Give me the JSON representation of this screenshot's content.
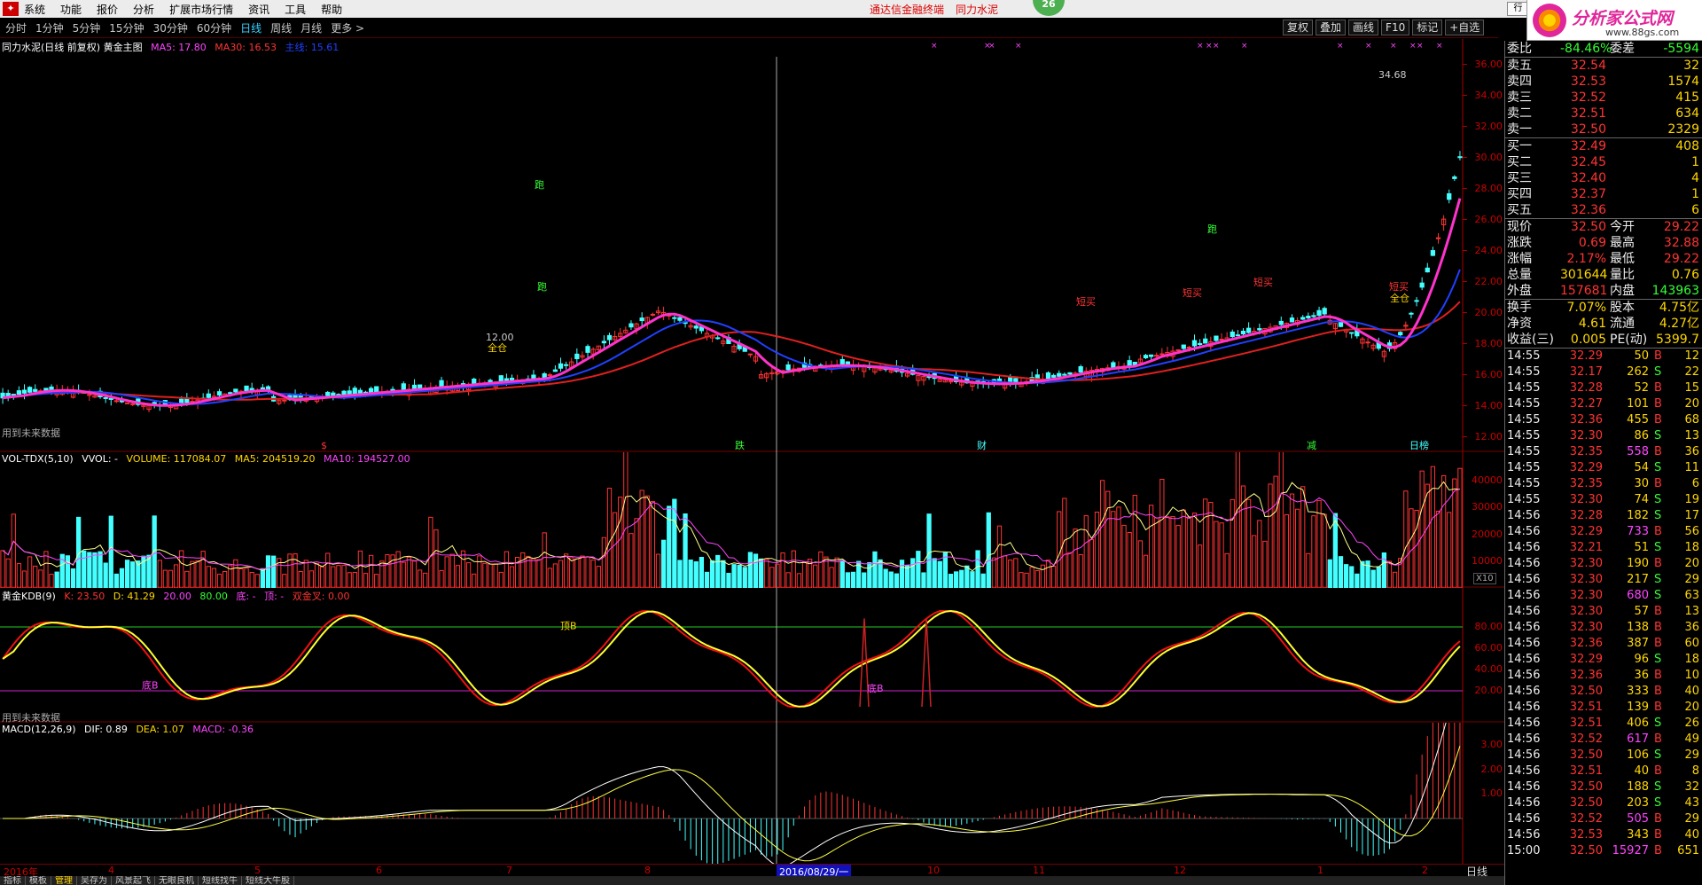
{
  "menu": {
    "items": [
      "系统",
      "功能",
      "报价",
      "分析",
      "扩展市场行情",
      "资讯",
      "工具",
      "帮助"
    ],
    "promo1": "通达信金融终端",
    "promo2": "同力水泥",
    "badge": "26",
    "ctrl": [
      "行",
      "-",
      "□",
      "x"
    ]
  },
  "logo": {
    "title": "分析家公式网",
    "url": "www.88gs.com"
  },
  "periods": [
    {
      "label": "分时"
    },
    {
      "label": "1分钟"
    },
    {
      "label": "5分钟"
    },
    {
      "label": "15分钟"
    },
    {
      "label": "30分钟"
    },
    {
      "label": "60分钟"
    },
    {
      "label": "日线",
      "active": true
    },
    {
      "label": "周线"
    },
    {
      "label": "月线"
    },
    {
      "label": "更多 >"
    }
  ],
  "tools": [
    "复权",
    "叠加",
    "画线",
    "F10",
    "标记",
    "+自选"
  ],
  "main": {
    "title": "同力水泥(日线 前复权) 黄金主图",
    "ma5": "MA5: 17.80",
    "ma30": "MA30: 16.53",
    "extra": "主线: 15.61",
    "yticks": [
      "36.00",
      "34.00",
      "32.00",
      "30.00",
      "28.00",
      "26.00",
      "24.00",
      "22.00",
      "20.00",
      "18.00",
      "16.00",
      "14.00",
      "12.00"
    ],
    "high_label": "34.68",
    "low_label": "12.00",
    "signals": [
      "跑",
      "跑",
      "跑",
      "全仓",
      "短买",
      "短买",
      "短买",
      "短买",
      "全仓"
    ],
    "note": "用到未来数据",
    "bottom_markers": [
      "$",
      "跌",
      "财",
      "减",
      "日榜"
    ]
  },
  "volume": {
    "title": "VOL-TDX(5,10)",
    "vvol": "VVOL: -",
    "volume": "VOLUME: 117084.07",
    "ma5": "MA5: 204519.20",
    "ma10": "MA10: 194527.00",
    "yticks": [
      "40000",
      "30000",
      "20000",
      "10000"
    ],
    "unit": "X10"
  },
  "kdb": {
    "title": "黄金KDB(9)",
    "k": "K: 23.50",
    "d": "D: 41.29",
    "p20": "20.00",
    "p80": "80.00",
    "bottom": "底: -",
    "top": "顶: -",
    "golden": "双金叉: 0.00",
    "yticks": [
      "80.00",
      "60.00",
      "40.00",
      "20.00"
    ],
    "labels": [
      "顶B",
      "底B",
      "底B"
    ],
    "note": "用到未来数据"
  },
  "macd": {
    "title": "MACD(12,26,9)",
    "dif": "DIF: 0.89",
    "dea": "DEA: 1.07",
    "macd": "MACD: -0.36",
    "yticks": [
      "3.00",
      "2.00",
      "1.00"
    ]
  },
  "xaxis": {
    "labels": [
      "2016年",
      "4",
      "5",
      "6",
      "7",
      "8",
      "10",
      "11",
      "12",
      "1",
      "2"
    ],
    "cursor": "2016/08/29/一",
    "period": "日线"
  },
  "bottom_tabs": [
    "指标",
    "模板",
    "管理",
    "吴存为",
    "风景起飞",
    "无眼良机",
    "短线找牛",
    "短线大牛股"
  ],
  "quote": {
    "weibi": {
      "k": "委比",
      "v": "-84.46%",
      "k2": "委差",
      "v2": "-5594"
    },
    "asks": [
      {
        "k": "卖五",
        "p": "32.54",
        "q": "32"
      },
      {
        "k": "卖四",
        "p": "32.53",
        "q": "1574"
      },
      {
        "k": "卖三",
        "p": "32.52",
        "q": "415"
      },
      {
        "k": "卖二",
        "p": "32.51",
        "q": "634"
      },
      {
        "k": "卖一",
        "p": "32.50",
        "q": "2329"
      }
    ],
    "bids": [
      {
        "k": "买一",
        "p": "32.49",
        "q": "408"
      },
      {
        "k": "买二",
        "p": "32.45",
        "q": "1"
      },
      {
        "k": "买三",
        "p": "32.40",
        "q": "4"
      },
      {
        "k": "买四",
        "p": "32.37",
        "q": "1"
      },
      {
        "k": "买五",
        "p": "32.36",
        "q": "6"
      }
    ],
    "stats": [
      {
        "k": "现价",
        "v": "32.50",
        "k2": "今开",
        "v2": "29.22"
      },
      {
        "k": "涨跌",
        "v": "0.69",
        "k2": "最高",
        "v2": "32.88"
      },
      {
        "k": "涨幅",
        "v": "2.17%",
        "k2": "最低",
        "v2": "29.22"
      },
      {
        "k": "总量",
        "v": "301644",
        "k2": "量比",
        "v2": "0.76"
      },
      {
        "k": "外盘",
        "v": "157681",
        "k2": "内盘",
        "v2": "143963"
      }
    ],
    "stats2": [
      {
        "k": "换手",
        "v": "7.07%",
        "k2": "股本",
        "v2": "4.75亿"
      },
      {
        "k": "净资",
        "v": "4.61",
        "k2": "流通",
        "v2": "4.27亿"
      },
      {
        "k": "收益(三)",
        "v": "0.005",
        "k2": "PE(动)",
        "v2": "5399.7"
      }
    ],
    "ticks": [
      [
        "14:55",
        "32.29",
        "50",
        "B",
        "12"
      ],
      [
        "14:55",
        "32.17",
        "262",
        "S",
        "22"
      ],
      [
        "14:55",
        "32.28",
        "52",
        "B",
        "15"
      ],
      [
        "14:55",
        "32.27",
        "101",
        "B",
        "20"
      ],
      [
        "14:55",
        "32.36",
        "455",
        "B",
        "68"
      ],
      [
        "14:55",
        "32.30",
        "86",
        "S",
        "13"
      ],
      [
        "14:55",
        "32.35",
        "558",
        "B",
        "36"
      ],
      [
        "14:55",
        "32.29",
        "54",
        "S",
        "11"
      ],
      [
        "14:55",
        "32.35",
        "30",
        "B",
        "6"
      ],
      [
        "14:55",
        "32.30",
        "74",
        "S",
        "19"
      ],
      [
        "14:56",
        "32.28",
        "182",
        "S",
        "17"
      ],
      [
        "14:56",
        "32.29",
        "733",
        "B",
        "56"
      ],
      [
        "14:56",
        "32.21",
        "51",
        "S",
        "18"
      ],
      [
        "14:56",
        "32.30",
        "190",
        "B",
        "20"
      ],
      [
        "14:56",
        "32.30",
        "217",
        "S",
        "29"
      ],
      [
        "14:56",
        "32.30",
        "680",
        "S",
        "63"
      ],
      [
        "14:56",
        "32.30",
        "57",
        "B",
        "13"
      ],
      [
        "14:56",
        "32.30",
        "138",
        "B",
        "36"
      ],
      [
        "14:56",
        "32.36",
        "387",
        "B",
        "60"
      ],
      [
        "14:56",
        "32.29",
        "96",
        "S",
        "18"
      ],
      [
        "14:56",
        "32.36",
        "36",
        "B",
        "10"
      ],
      [
        "14:56",
        "32.50",
        "333",
        "B",
        "40"
      ],
      [
        "14:56",
        "32.51",
        "139",
        "B",
        "20"
      ],
      [
        "14:56",
        "32.51",
        "406",
        "S",
        "26"
      ],
      [
        "14:56",
        "32.52",
        "617",
        "B",
        "49"
      ],
      [
        "14:56",
        "32.50",
        "106",
        "S",
        "29"
      ],
      [
        "14:56",
        "32.51",
        "40",
        "B",
        "8"
      ],
      [
        "14:56",
        "32.50",
        "188",
        "S",
        "32"
      ],
      [
        "14:56",
        "32.50",
        "203",
        "S",
        "43"
      ],
      [
        "14:56",
        "32.52",
        "505",
        "B",
        "29"
      ],
      [
        "14:56",
        "32.53",
        "343",
        "B",
        "40"
      ],
      [
        "15:00",
        "32.50",
        "15927",
        "B",
        "651"
      ]
    ]
  }
}
